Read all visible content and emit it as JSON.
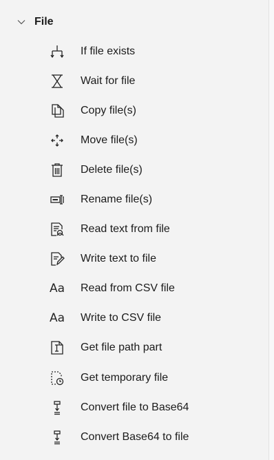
{
  "group": {
    "title": "File",
    "expanded": true
  },
  "items": [
    {
      "label": "If file exists",
      "icon": "if-branch-icon"
    },
    {
      "label": "Wait for file",
      "icon": "hourglass-icon"
    },
    {
      "label": "Copy file(s)",
      "icon": "copy-file-icon"
    },
    {
      "label": "Move file(s)",
      "icon": "move-arrows-icon"
    },
    {
      "label": "Delete file(s)",
      "icon": "trash-icon"
    },
    {
      "label": "Rename file(s)",
      "icon": "rename-icon"
    },
    {
      "label": "Read text from file",
      "icon": "read-text-icon"
    },
    {
      "label": "Write text to file",
      "icon": "write-text-icon"
    },
    {
      "label": "Read from CSV file",
      "icon": "aa-text-icon"
    },
    {
      "label": "Write to CSV file",
      "icon": "aa-text-icon"
    },
    {
      "label": "Get file path part",
      "icon": "file-path-icon"
    },
    {
      "label": "Get temporary file",
      "icon": "temp-file-clock-icon"
    },
    {
      "label": "Convert file to Base64",
      "icon": "convert-icon"
    },
    {
      "label": "Convert Base64 to file",
      "icon": "convert-icon"
    }
  ],
  "aa_glyph": "Aa"
}
